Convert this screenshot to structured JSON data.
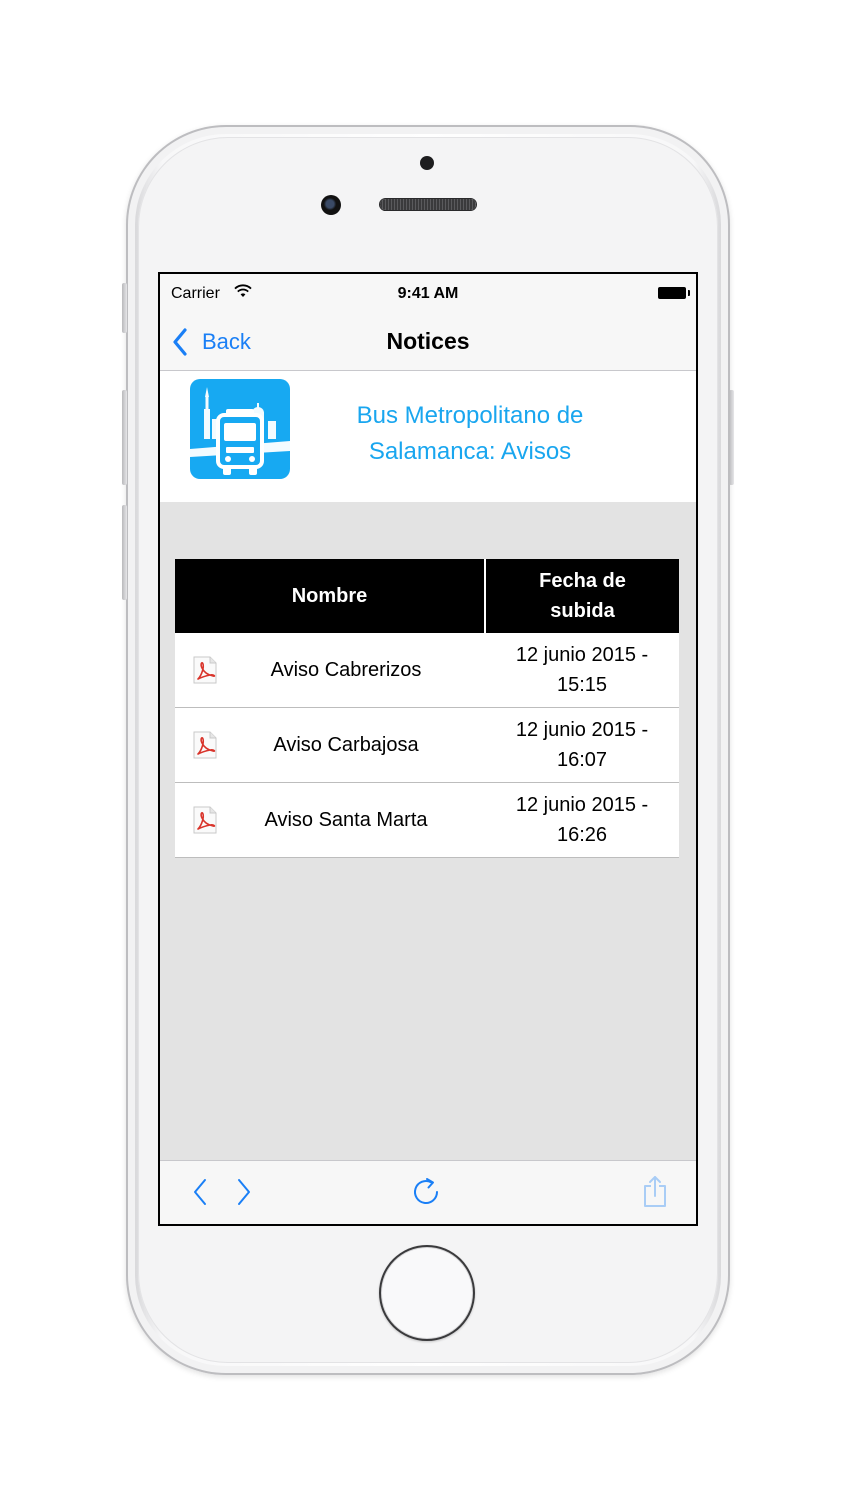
{
  "status_bar": {
    "carrier": "Carrier",
    "time": "9:41 AM"
  },
  "nav": {
    "back_label": "Back",
    "title": "Notices"
  },
  "header": {
    "title_line1": "Bus Metropolitano de",
    "title_line2": "Salamanca: Avisos"
  },
  "table": {
    "columns": [
      "Nombre",
      "Fecha de\nsubida"
    ],
    "rows": [
      {
        "icon": "pdf-icon",
        "name": "Aviso Cabrerizos",
        "date": "12 junio 2015 -\n15:15"
      },
      {
        "icon": "pdf-icon",
        "name": "Aviso Carbajosa",
        "date": "12 junio 2015 -\n16:07"
      },
      {
        "icon": "pdf-icon",
        "name": "Aviso Santa Marta",
        "date": "12 junio 2015 -\n16:26"
      }
    ]
  },
  "toolbar": {
    "icons": [
      "chevron-left-icon",
      "chevron-right-icon",
      "refresh-icon",
      "share-icon"
    ]
  },
  "colors": {
    "accent": "#1a7ff6",
    "logo_bg": "#17a9f2",
    "header_text": "#19a6ef",
    "table_header": "#000000",
    "content_bg": "#e3e3e3"
  }
}
